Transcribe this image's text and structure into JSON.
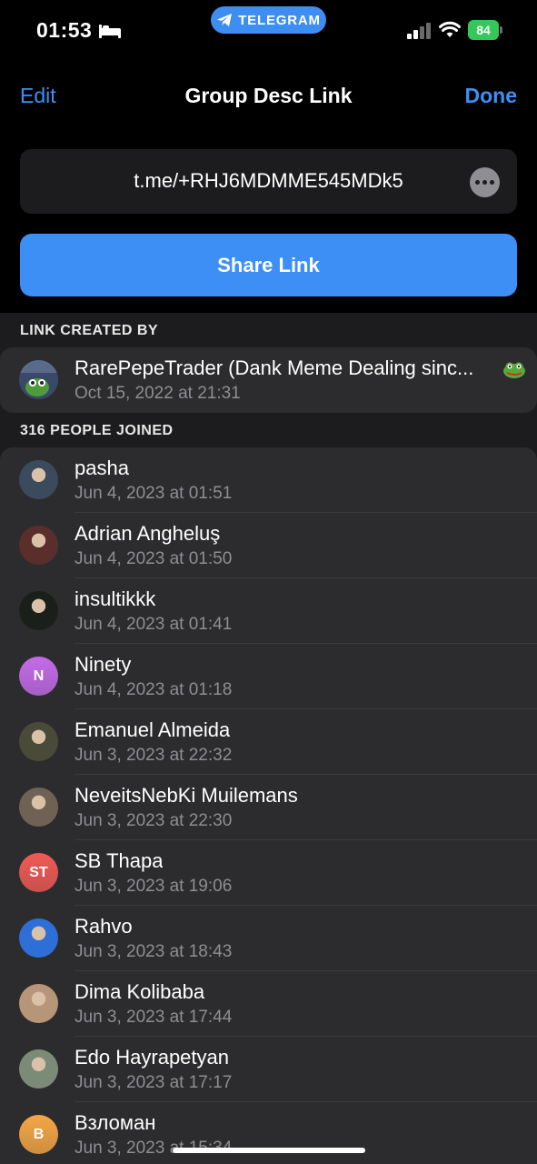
{
  "status_bar": {
    "time": "01:53",
    "pill_label": "TELEGRAM",
    "battery": "84"
  },
  "nav": {
    "edit_label": "Edit",
    "title": "Group Desc Link",
    "done_label": "Done"
  },
  "invite_link": "t.me/+RHJ6MDMME545MDk5",
  "share_label": "Share Link",
  "created_section": {
    "header": "LINK CREATED BY",
    "creator": {
      "name": "RarePepeTrader (Dank Meme Dealing sinc...",
      "date": "Oct 15, 2022 at 21:31"
    }
  },
  "joined_section": {
    "header": "316 PEOPLE JOINED",
    "members": [
      {
        "name": "pasha",
        "date": "Jun 4, 2023 at 01:51",
        "initials": "",
        "color": "#3b4a5c"
      },
      {
        "name": "Adrian Angheluş",
        "date": "Jun 4, 2023 at 01:50",
        "initials": "",
        "color": "#5a2e2a"
      },
      {
        "name": "insultikkk",
        "date": "Jun 4, 2023 at 01:41",
        "initials": "",
        "color": "#1a1f1a"
      },
      {
        "name": "Ninety",
        "date": "Jun 4, 2023 at 01:18",
        "initials": "N",
        "color": "#c46be8"
      },
      {
        "name": "Emanuel Almeida",
        "date": "Jun 3, 2023 at 22:32",
        "initials": "",
        "color": "#4a4a38"
      },
      {
        "name": "NeveitsNebKi Muilemans",
        "date": "Jun 3, 2023 at 22:30",
        "initials": "",
        "color": "#6f6254"
      },
      {
        "name": "SB Thapa",
        "date": "Jun 3, 2023 at 19:06",
        "initials": "ST",
        "color": "#ef5a55"
      },
      {
        "name": "Rahvo",
        "date": "Jun 3, 2023 at 18:43",
        "initials": "",
        "color": "#2d6fd6"
      },
      {
        "name": "Dima Kolibaba",
        "date": "Jun 3, 2023 at 17:44",
        "initials": "",
        "color": "#b79578"
      },
      {
        "name": "Edo Hayrapetyan",
        "date": "Jun 3, 2023 at 17:17",
        "initials": "",
        "color": "#7c8a78"
      },
      {
        "name": "Взломан",
        "date": "Jun 3, 2023 at 15:34",
        "initials": "B",
        "color": "#f5a646"
      }
    ]
  }
}
